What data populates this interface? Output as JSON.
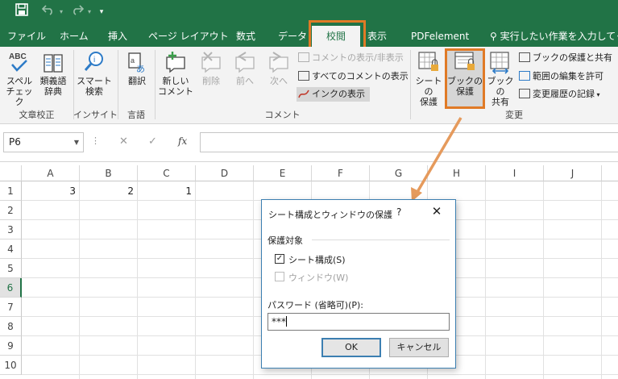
{
  "colors": {
    "accent": "#217346",
    "highlight": "#e07a26",
    "dialog_border": "#3c7fb1"
  },
  "quick_access": {
    "save_icon": "save-icon",
    "undo_icon": "undo-icon",
    "redo_icon": "redo-icon",
    "customize_icon": "customize-qat-icon"
  },
  "tabs": [
    {
      "label": "ファイル"
    },
    {
      "label": "ホーム"
    },
    {
      "label": "挿入"
    },
    {
      "label": "ページ レイアウト"
    },
    {
      "label": "数式"
    },
    {
      "label": "データ"
    },
    {
      "label": "校閲",
      "active": true
    },
    {
      "label": "表示"
    },
    {
      "label": "PDFelement"
    }
  ],
  "tell_me": "実行したい作業を入力してくだ",
  "ribbon": {
    "groups": [
      {
        "label": "文章校正"
      },
      {
        "label": "インサイト"
      },
      {
        "label": "言語"
      },
      {
        "label": "コメント"
      },
      {
        "label": "変更"
      }
    ],
    "spell_check": {
      "label1": "スペル",
      "label2": "チェック"
    },
    "thesaurus": {
      "label1": "類義語",
      "label2": "辞典"
    },
    "smart_lookup": {
      "label1": "スマート",
      "label2": "検索"
    },
    "translate": {
      "label1": "翻訳"
    },
    "new_comment": {
      "label1": "新しい",
      "label2": "コメント"
    },
    "delete": {
      "label1": "削除"
    },
    "previous": {
      "label1": "前へ"
    },
    "next": {
      "label1": "次へ"
    },
    "show_hide_comment": "コメントの表示/非表示",
    "show_all_comments": "すべてのコメントの表示",
    "show_ink": "インクの表示",
    "protect_sheet": {
      "label1": "シートの",
      "label2": "保護"
    },
    "protect_workbook": {
      "label1": "ブックの",
      "label2": "保護"
    },
    "share_workbook": {
      "label1": "ブックの",
      "label2": "共有"
    },
    "protect_and_share": "ブックの保護と共有",
    "allow_edit_ranges": "範囲の編集を許可",
    "track_changes": "変更履歴の記録"
  },
  "formula_bar": {
    "name_box": "P6",
    "fx": "fx",
    "value": ""
  },
  "columns": [
    "A",
    "B",
    "C",
    "D",
    "E",
    "F",
    "G",
    "H",
    "I",
    "J"
  ],
  "rows": [
    "1",
    "2",
    "3",
    "4",
    "5",
    "6",
    "7",
    "8",
    "9",
    "10"
  ],
  "selected_row": "6",
  "cells": {
    "A1": "3",
    "B1": "2",
    "C1": "1"
  },
  "dialog": {
    "title": "シート構成とウィンドウの保護",
    "help": "?",
    "close": "✕",
    "group_label": "保護対象",
    "option_structure": "シート構成(S)",
    "option_structure_checked": true,
    "option_windows": "ウィンドウ(W)",
    "option_windows_checked": false,
    "password_label": "パスワード (省略可)(P):",
    "password_value": "***",
    "ok_label": "OK",
    "cancel_label": "キャンセル"
  }
}
